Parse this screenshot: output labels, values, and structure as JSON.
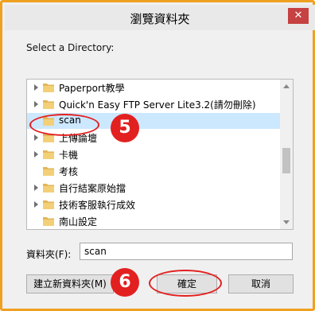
{
  "window": {
    "title": "瀏覽資料夾",
    "close_glyph": "✕"
  },
  "prompt": "Select a Directory:",
  "tree": {
    "items": [
      {
        "label": "Paperport教學",
        "expandable": true,
        "selected": false
      },
      {
        "label": "Quick'n Easy FTP Server Lite3.2(請勿刪除)",
        "expandable": true,
        "selected": false
      },
      {
        "label": "scan",
        "expandable": false,
        "selected": true
      },
      {
        "label": "上傳論壇",
        "expandable": true,
        "selected": false
      },
      {
        "label": "卡機",
        "expandable": true,
        "selected": false
      },
      {
        "label": "考核",
        "expandable": false,
        "selected": false
      },
      {
        "label": "自行結案原始擋",
        "expandable": true,
        "selected": false
      },
      {
        "label": "技術客服執行成效",
        "expandable": true,
        "selected": false
      },
      {
        "label": "南山設定",
        "expandable": false,
        "selected": false
      }
    ]
  },
  "folder_field": {
    "label": "資料夾(F):",
    "value": "scan"
  },
  "buttons": {
    "new_folder": "建立新資料夾(M)",
    "ok": "確定",
    "cancel": "取消"
  },
  "annotations": {
    "step5": "5",
    "step6": "6"
  },
  "colors": {
    "highlight": "#e32020",
    "frame": "#f0a020",
    "folder": "#e8c060"
  }
}
